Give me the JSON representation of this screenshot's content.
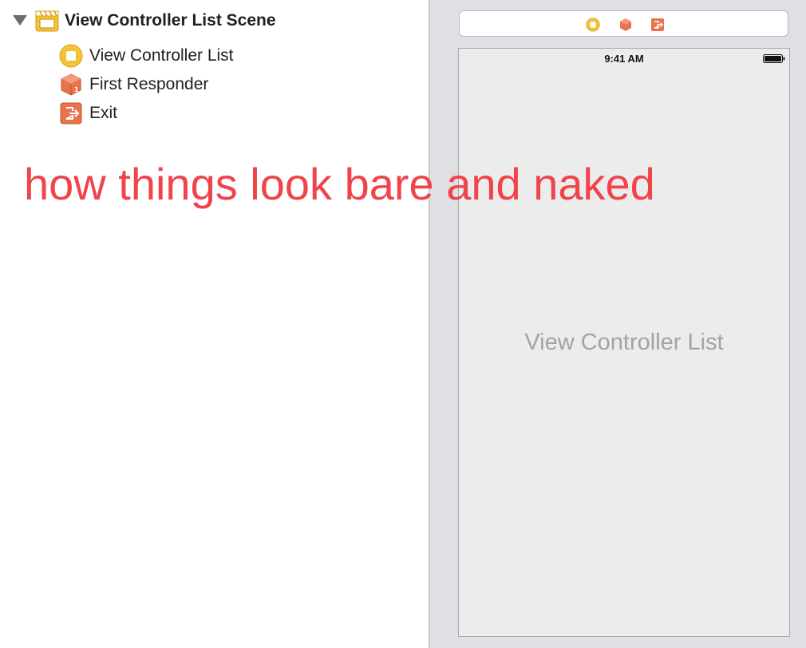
{
  "outline": {
    "scene_title": "View Controller List Scene",
    "items": [
      {
        "label": "View Controller List",
        "icon": "view-controller-icon"
      },
      {
        "label": "First Responder",
        "icon": "first-responder-icon"
      },
      {
        "label": "Exit",
        "icon": "exit-icon"
      }
    ]
  },
  "canvas": {
    "status_time": "9:41 AM",
    "view_title": "View Controller List"
  },
  "annotation": "how things look bare and naked",
  "colors": {
    "annotation_red": "#f0434a",
    "view_controller_yellow": "#f5c435",
    "first_responder_orange": "#e8734c",
    "exit_orange": "#e8734c",
    "canvas_background": "#dfe0e3",
    "view_background": "#ececec"
  }
}
